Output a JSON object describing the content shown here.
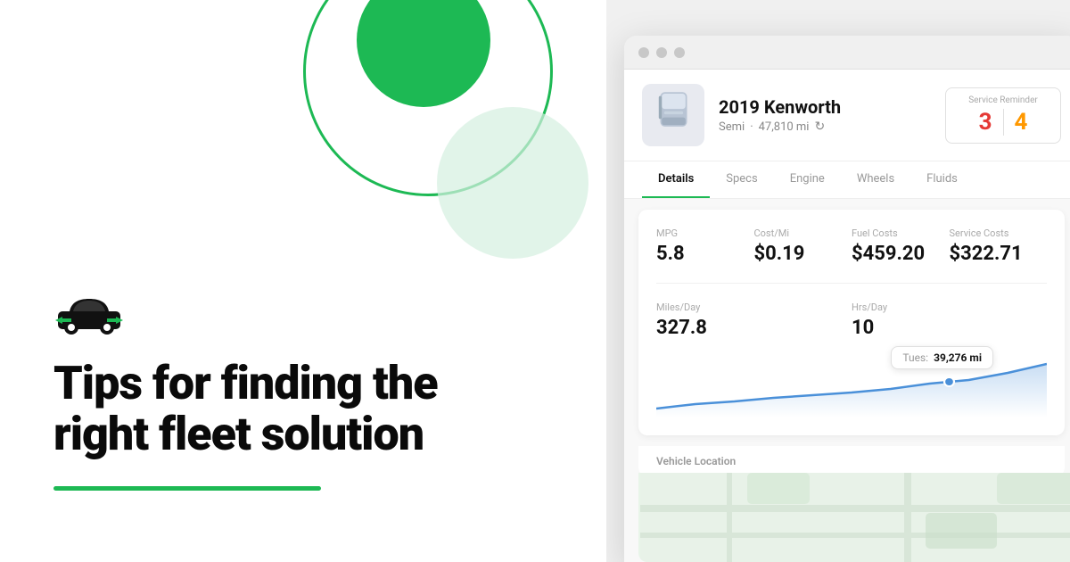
{
  "left": {
    "headline_line1": "Tips for finding the",
    "headline_line2": "right fleet solution"
  },
  "right": {
    "window_dots": [
      "dot1",
      "dot2",
      "dot3"
    ],
    "vehicle": {
      "name": "2019 Kenworth",
      "type": "Semi",
      "miles": "47,810 mi",
      "service_reminder_label": "Service Reminder",
      "service_red": "3",
      "service_orange": "4"
    },
    "tabs": [
      {
        "label": "Details",
        "active": true
      },
      {
        "label": "Specs",
        "active": false
      },
      {
        "label": "Engine",
        "active": false
      },
      {
        "label": "Wheels",
        "active": false
      },
      {
        "label": "Fluids",
        "active": false
      }
    ],
    "stats": {
      "mpg_label": "MPG",
      "mpg_value": "5.8",
      "cost_per_mi_label": "Cost/Mi",
      "cost_per_mi_value": "$0.19",
      "fuel_costs_label": "Fuel Costs",
      "fuel_costs_value": "$459.20",
      "service_costs_label": "Service Costs",
      "service_costs_value": "$322.71",
      "miles_day_label": "Miles/Day",
      "miles_day_value": "327.8",
      "hrs_day_label": "Hrs/Day",
      "hrs_day_value": "10"
    },
    "chart": {
      "tooltip_label": "Tues:",
      "tooltip_value": "39,276 mi"
    },
    "vehicle_location_label": "Vehicle Location"
  }
}
